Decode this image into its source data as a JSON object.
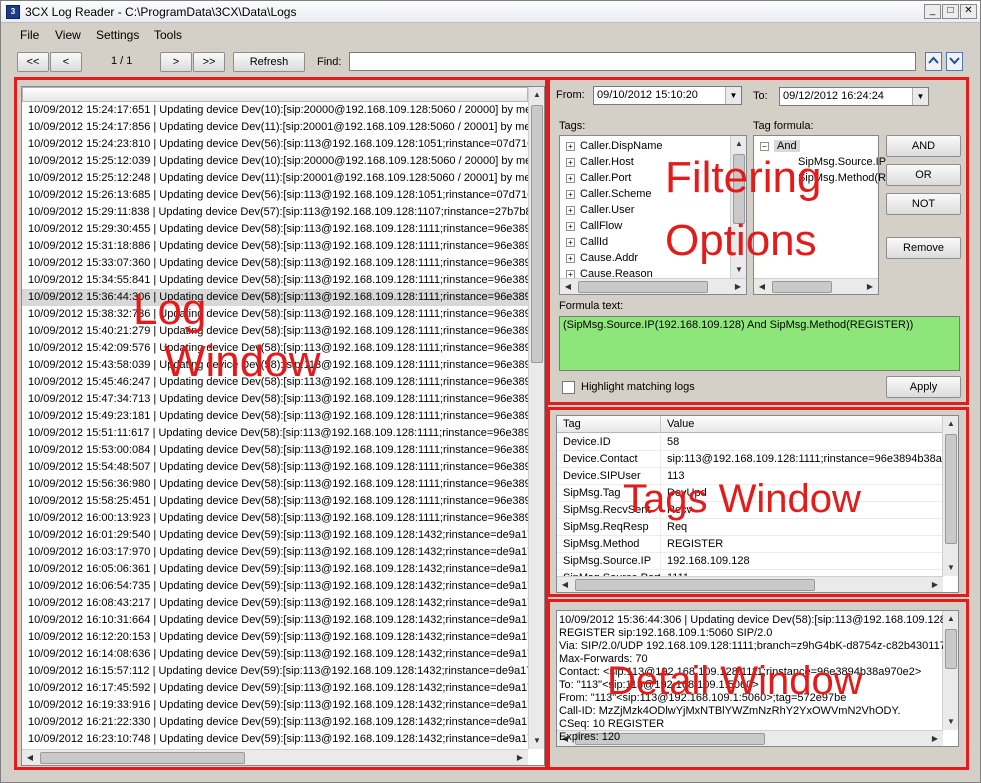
{
  "window": {
    "title": "3CX Log Reader - C:\\ProgramData\\3CX\\Data\\Logs",
    "minimize": "_",
    "maximize": "□",
    "close": "✕"
  },
  "menu": [
    "File",
    "View",
    "Settings",
    "Tools"
  ],
  "toolbar": {
    "first": "<<",
    "prev": "<",
    "page": "1 / 1",
    "next": ">",
    "last": ">>",
    "refresh": "Refresh",
    "find_label": "Find:",
    "find_value": "",
    "up_icon": "chevron-up-icon",
    "down_icon": "chevron-down-icon"
  },
  "overlays": {
    "log": [
      "Log",
      "Window"
    ],
    "filtering": [
      "Filtering",
      "Options"
    ],
    "tags": "Tags Window",
    "detail": "Detail Window",
    "color": "#e21b1b"
  },
  "log": {
    "selected_index": 11,
    "rows": [
      "10/09/2012 15:24:17:651 | Updating device Dev(10):[sip:20000@192.168.109.128:5060 / 20000] by me",
      "10/09/2012 15:24:17:856 | Updating device Dev(11):[sip:20001@192.168.109.128:5060 / 20001] by me",
      "10/09/2012 15:24:23:810 | Updating device Dev(56):[sip:113@192.168.109.128:1051;rinstance=07d716",
      "10/09/2012 15:25:12:039 | Updating device Dev(10):[sip:20000@192.168.109.128:5060 / 20000] by me",
      "10/09/2012 15:25:12:248 | Updating device Dev(11):[sip:20001@192.168.109.128:5060 / 20001] by me",
      "10/09/2012 15:26:13:685 | Updating device Dev(56):[sip:113@192.168.109.128:1051;rinstance=07d716",
      "10/09/2012 15:29:11:838 | Updating device Dev(57):[sip:113@192.168.109.128:1107;rinstance=27b7b8",
      "10/09/2012 15:29:30:455 | Updating device Dev(58):[sip:113@192.168.109.128:1111;rinstance=96e389",
      "10/09/2012 15:31:18:886 | Updating device Dev(58):[sip:113@192.168.109.128:1111;rinstance=96e389",
      "10/09/2012 15:33:07:360 | Updating device Dev(58):[sip:113@192.168.109.128:1111;rinstance=96e389",
      "10/09/2012 15:34:55:841 | Updating device Dev(58):[sip:113@192.168.109.128:1111;rinstance=96e389",
      "10/09/2012 15:36:44:306 | Updating device Dev(58):[sip:113@192.168.109.128:1111;rinstance=96e389",
      "10/09/2012 15:38:32:736 | Updating device Dev(58):[sip:113@192.168.109.128:1111;rinstance=96e389",
      "10/09/2012 15:40:21:279 | Updating device Dev(58):[sip:113@192.168.109.128:1111;rinstance=96e389",
      "10/09/2012 15:42:09:576 | Updating device Dev(58):[sip:113@192.168.109.128:1111;rinstance=96e389",
      "10/09/2012 15:43:58:039 | Updating device Dev(58):[sip:113@192.168.109.128:1111;rinstance=96e389",
      "10/09/2012 15:45:46:247 | Updating device Dev(58):[sip:113@192.168.109.128:1111;rinstance=96e389",
      "10/09/2012 15:47:34:713 | Updating device Dev(58):[sip:113@192.168.109.128:1111;rinstance=96e389",
      "10/09/2012 15:49:23:181 | Updating device Dev(58):[sip:113@192.168.109.128:1111;rinstance=96e389",
      "10/09/2012 15:51:11:617 | Updating device Dev(58):[sip:113@192.168.109.128:1111;rinstance=96e389",
      "10/09/2012 15:53:00:084 | Updating device Dev(58):[sip:113@192.168.109.128:1111;rinstance=96e389",
      "10/09/2012 15:54:48:507 | Updating device Dev(58):[sip:113@192.168.109.128:1111;rinstance=96e389",
      "10/09/2012 15:56:36:980 | Updating device Dev(58):[sip:113@192.168.109.128:1111;rinstance=96e389",
      "10/09/2012 15:58:25:451 | Updating device Dev(58):[sip:113@192.168.109.128:1111;rinstance=96e389",
      "10/09/2012 16:00:13:923 | Updating device Dev(58):[sip:113@192.168.109.128:1111;rinstance=96e389",
      "10/09/2012 16:01:29:540 | Updating device Dev(59):[sip:113@192.168.109.128:1432;rinstance=de9a17",
      "10/09/2012 16:03:17:970 | Updating device Dev(59):[sip:113@192.168.109.128:1432;rinstance=de9a17",
      "10/09/2012 16:05:06:361 | Updating device Dev(59):[sip:113@192.168.109.128:1432;rinstance=de9a17",
      "10/09/2012 16:06:54:735 | Updating device Dev(59):[sip:113@192.168.109.128:1432;rinstance=de9a17",
      "10/09/2012 16:08:43:217 | Updating device Dev(59):[sip:113@192.168.109.128:1432;rinstance=de9a17",
      "10/09/2012 16:10:31:664 | Updating device Dev(59):[sip:113@192.168.109.128:1432;rinstance=de9a17",
      "10/09/2012 16:12:20:153 | Updating device Dev(59):[sip:113@192.168.109.128:1432;rinstance=de9a17",
      "10/09/2012 16:14:08:636 | Updating device Dev(59):[sip:113@192.168.109.128:1432;rinstance=de9a17",
      "10/09/2012 16:15:57:112 | Updating device Dev(59):[sip:113@192.168.109.128:1432;rinstance=de9a17",
      "10/09/2012 16:17:45:592 | Updating device Dev(59):[sip:113@192.168.109.128:1432;rinstance=de9a17",
      "10/09/2012 16:19:33:916 | Updating device Dev(59):[sip:113@192.168.109.128:1432;rinstance=de9a17",
      "10/09/2012 16:21:22:330 | Updating device Dev(59):[sip:113@192.168.109.128:1432;rinstance=de9a17",
      "10/09/2012 16:23:10:748 | Updating device Dev(59):[sip:113@192.168.109.128:1432;rinstance=de9a17"
    ]
  },
  "filter": {
    "from_label": "From:",
    "from_value": "09/10/2012 15:10:20",
    "to_label": "To:",
    "to_value": "09/12/2012 16:24:24",
    "tags_label": "Tags:",
    "tags": [
      "Caller.DispName",
      "Caller.Host",
      "Caller.Port",
      "Caller.Scheme",
      "Caller.User",
      "CallFlow",
      "CallId",
      "Cause.Addr",
      "Cause.Reason"
    ],
    "tag_formula_label": "Tag formula:",
    "formula_tree": {
      "root": "And",
      "children": [
        "SipMsg.Source.IP",
        "SipMsg.Method(R"
      ]
    },
    "buttons": {
      "and": "AND",
      "or": "OR",
      "not": "NOT",
      "remove": "Remove"
    },
    "formula_text_label": "Formula text:",
    "formula_text": "(SipMsg.Source.IP(192.168.109.128) And SipMsg.Method(REGISTER))",
    "highlight_label": "Highlight matching logs",
    "highlight_checked": false,
    "apply": "Apply",
    "formula_color": "#8ee67a"
  },
  "tags_table": {
    "columns": [
      "Tag",
      "Value"
    ],
    "rows": [
      {
        "tag": "Device.ID",
        "value": "58"
      },
      {
        "tag": "Device.Contact",
        "value": "sip:113@192.168.109.128:1111;rinstance=96e3894b38a9"
      },
      {
        "tag": "Device.SIPUser",
        "value": "113"
      },
      {
        "tag": "SipMsg.Tag",
        "value": "DevUpd"
      },
      {
        "tag": "SipMsg.RecvSent",
        "value": "Recv"
      },
      {
        "tag": "SipMsg.ReqResp",
        "value": "Req"
      },
      {
        "tag": "SipMsg.Method",
        "value": "REGISTER"
      },
      {
        "tag": "SipMsg.Source.IP",
        "value": "192.168.109.128"
      },
      {
        "tag": "SipMsg.Source.Port",
        "value": "1111"
      }
    ]
  },
  "detail": {
    "lines": [
      "10/09/2012 15:36:44:306 | Updating device Dev(58):[sip:113@192.168.109.128",
      "REGISTER sip:192.168.109.1:5060 SIP/2.0",
      "Via: SIP/2.0/UDP 192.168.109.128:1111;branch=z9hG4bK-d8754z-c82b430117",
      "Max-Forwards: 70",
      "Contact: <sip:113@192.168.109.128:1111;rinstance=96e3894b38a970e2>",
      "To: \"113\"<sip:113@192.168.109.1:5060>",
      "From: \"113\"<sip:113@192.168.109.1:5060>;tag=572e97be",
      "Call-ID: MzZjMzk4ODlwYjMxNTBlYWZmNzRhY2YxOWVmN2VhODY.",
      "CSeq: 10 REGISTER",
      "Expires: 120"
    ]
  }
}
